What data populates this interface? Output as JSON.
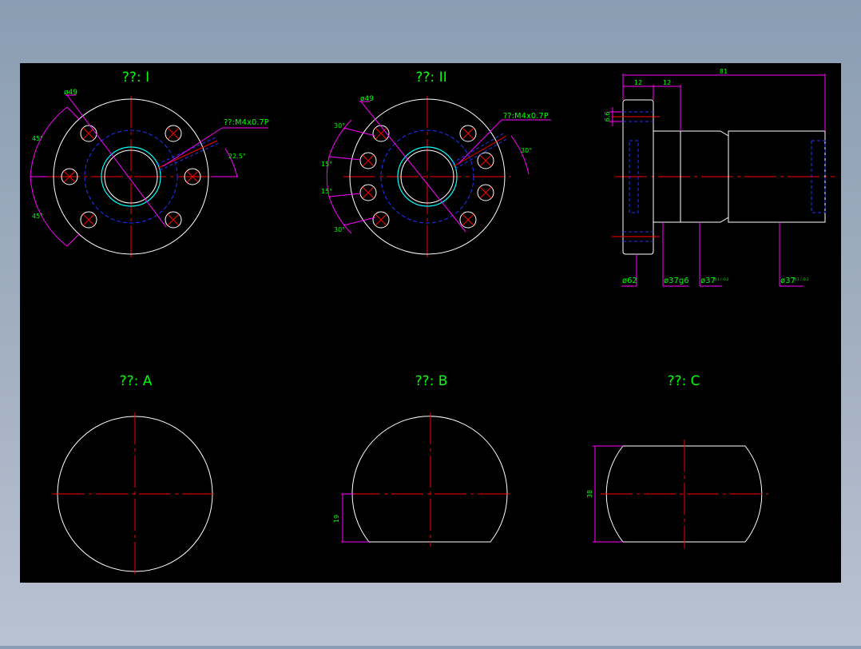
{
  "colors": {
    "background_outer": "#8a9db2",
    "canvas": "#000000",
    "outline": "#ffffff",
    "centerline": "#ff0000",
    "hidden": "#0000ff",
    "dimension": "#ff00ff",
    "text": "#00ff00",
    "thread": "#00ffff"
  },
  "views": {
    "type_i": {
      "title": "??: I"
    },
    "type_ii": {
      "title": "??: II"
    },
    "a": {
      "title": "??: A"
    },
    "b": {
      "title": "??: B"
    },
    "c": {
      "title": "??: C"
    }
  },
  "dims": {
    "i_bolt_circle": "ø49",
    "i_thread": "??:M4x0.7P",
    "i_angle_top": "45°",
    "i_angle_bottom": "45°",
    "i_angle_thread": "22.5°",
    "ii_bolt_circle": "ø49",
    "ii_thread": "??:M4x0.7P",
    "ii_angle_1": "30°",
    "ii_angle_2": "15°",
    "ii_angle_3": "15°",
    "ii_angle_4": "30°",
    "ii_angle_thread": "30°",
    "side_length": "81",
    "side_flange": "12",
    "side_step": "12",
    "side_hole": "6.6",
    "side_d1": "ø62",
    "side_d2": "ø37g6",
    "side_d3": "ø37",
    "side_d3_tol": "-0.1 / -0.2",
    "side_d4": "ø37",
    "side_d4_tol": "-0.1 / -0.2",
    "b_flat": "19",
    "c_width": "38"
  }
}
